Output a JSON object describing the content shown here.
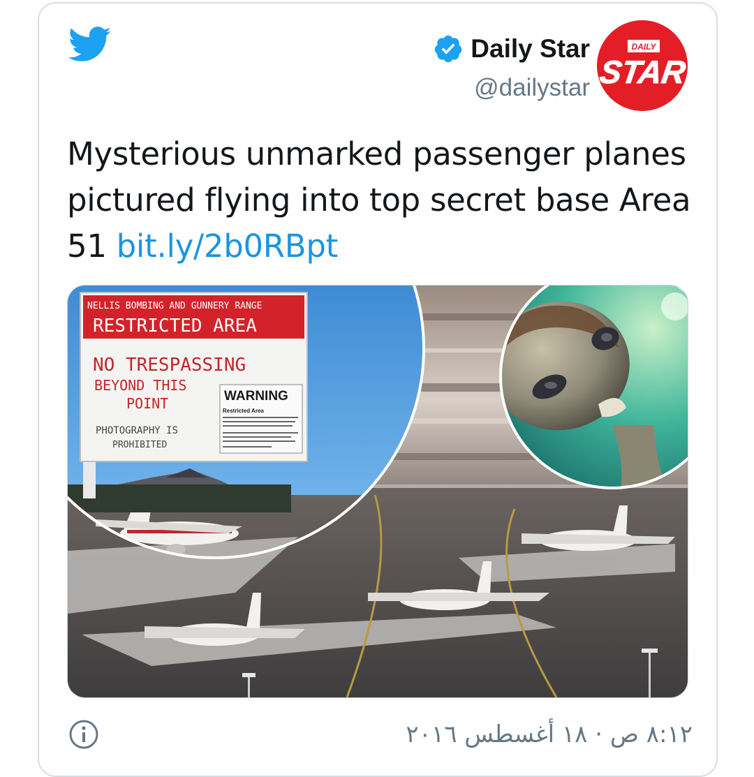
{
  "tweet": {
    "author_name": "Daily Star",
    "author_handle": "@dailystar",
    "avatar_text_small": "DAILY",
    "avatar_text_large": "STAR",
    "text_main": "Mysterious unmarked passenger planes pictured flying into top secret base Area 51 ",
    "link_text": "bit.ly/2b0RBpt",
    "timestamp": "٨:١٢ ص · ١٨ أغسطس ٢٠١٦"
  },
  "image": {
    "sign_header": "NELLIS BOMBING AND GUNNERY RANGE",
    "sign_restricted": "RESTRICTED AREA",
    "sign_no_trespassing": "NO TRESPASSING",
    "sign_beyond": "BEYOND THIS",
    "sign_point": "POINT",
    "sign_warning": "WARNING",
    "sign_restricted_small": "Restricted Area",
    "sign_photography": "PHOTOGRAPHY IS",
    "sign_prohibited": "PROHIBITED"
  },
  "colors": {
    "twitter_blue": "#1da1f2",
    "link_blue": "#1b95e0",
    "avatar_red": "#e41e26",
    "verified_blue": "#1da1f2"
  }
}
